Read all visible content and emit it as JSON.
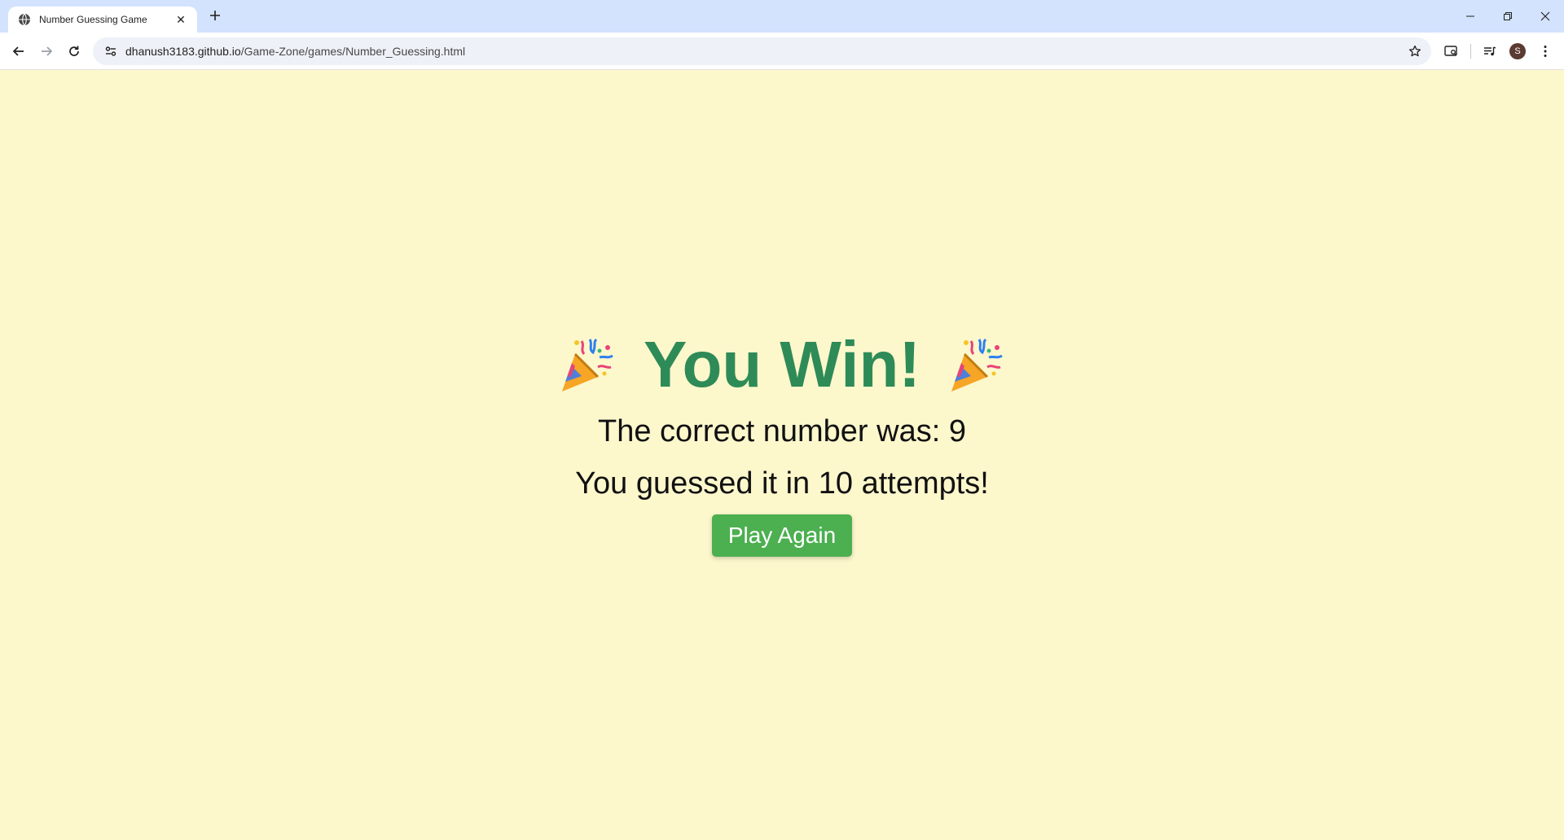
{
  "browser": {
    "tab": {
      "title": "Number Guessing Game",
      "close_glyph": "✕"
    },
    "new_tab_glyph": "+",
    "address": {
      "host": "dhanush3183.github.io",
      "path": "/Game-Zone/games/Number_Guessing.html"
    },
    "profile_initial": "S"
  },
  "game": {
    "party_emoji_left": "🎉",
    "win_title": "You Win!",
    "party_emoji_right": "🎉",
    "correct_number_text": "The correct number was: 9",
    "attempts_text": "You guessed it in 10 attempts!",
    "play_again_label": "Play Again"
  },
  "colors": {
    "page_background": "#fdf7cc",
    "win_title": "#2e8b57",
    "play_button": "#4caf50"
  }
}
